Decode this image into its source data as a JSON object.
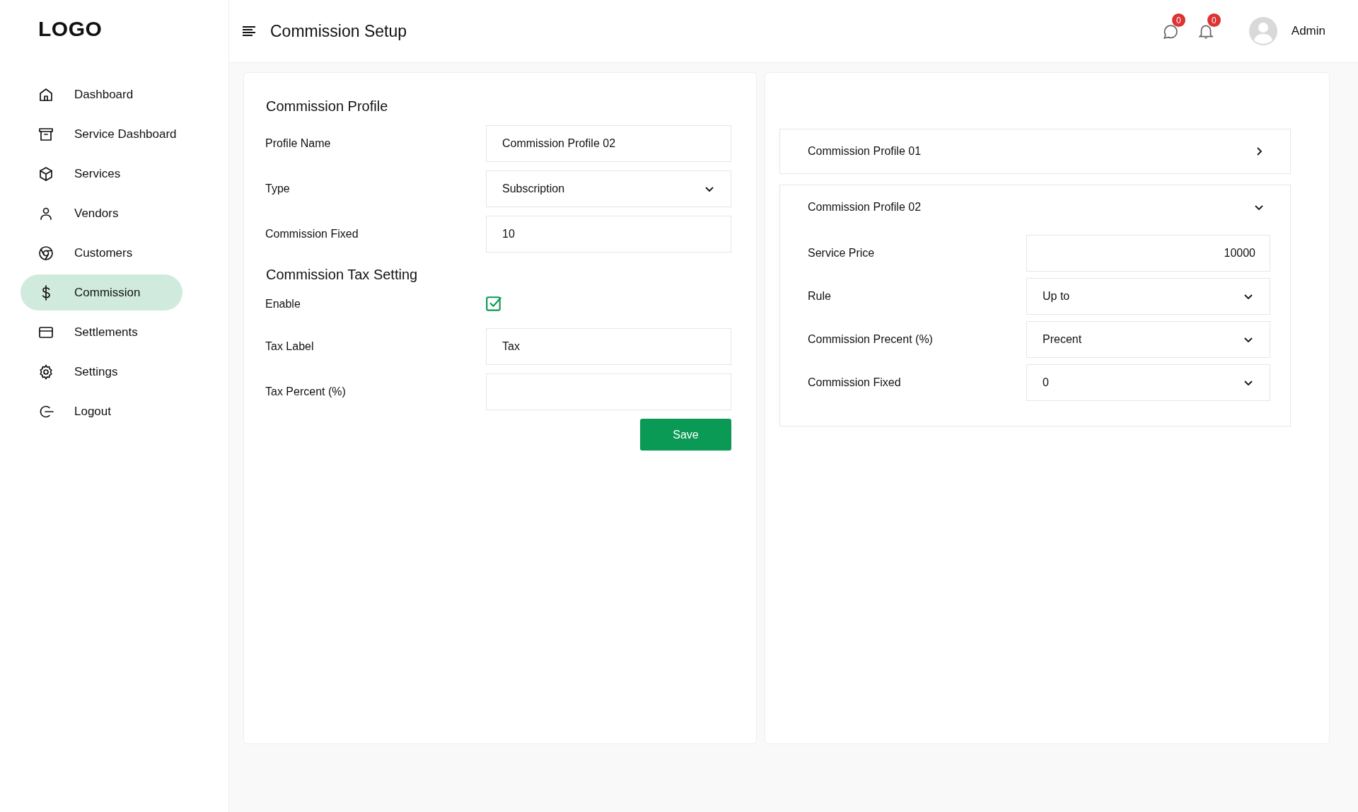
{
  "logo": "LOGO",
  "sidebar": {
    "items": [
      {
        "label": "Dashboard",
        "selected": false
      },
      {
        "label": "Service Dashboard",
        "selected": false
      },
      {
        "label": "Services",
        "selected": false
      },
      {
        "label": "Vendors",
        "selected": false
      },
      {
        "label": "Customers",
        "selected": false
      },
      {
        "label": "Commission",
        "selected": true
      },
      {
        "label": "Settlements",
        "selected": false
      },
      {
        "label": "Settings",
        "selected": false
      },
      {
        "label": "Logout",
        "selected": false
      }
    ]
  },
  "header": {
    "title": "Commission Setup",
    "messages_badge": "0",
    "notifications_badge": "0",
    "user": "Admin"
  },
  "profile_form": {
    "title": "Commission Profile",
    "fields": [
      {
        "kind": "text",
        "label": "Profile Name",
        "value": "Commission Profile 02"
      },
      {
        "kind": "select",
        "label": "Type",
        "value": "Subscription"
      },
      {
        "kind": "text",
        "label": "Commission Fixed",
        "value": "10"
      }
    ]
  },
  "tax_form": {
    "title": "Commission Tax Setting",
    "fields": [
      {
        "kind": "checkbox",
        "label": "Enable",
        "checked": true
      },
      {
        "kind": "text",
        "label": "Tax Label",
        "value": "Tax"
      },
      {
        "kind": "text",
        "label": "Tax Percent (%)"
      }
    ],
    "save_button": "Save"
  },
  "profiles": [
    {
      "title": "Commission Profile 01",
      "expanded": false
    },
    {
      "title": "Commission Profile 02",
      "expanded": true,
      "fields": [
        {
          "kind": "number",
          "label": "Service Price",
          "value": "10000"
        },
        {
          "kind": "select",
          "label": "Rule",
          "value": "Up to"
        },
        {
          "kind": "select",
          "label": "Commission Precent (%)",
          "value": "Precent"
        },
        {
          "kind": "select",
          "label": "Commission Fixed",
          "value": "0"
        }
      ]
    }
  ]
}
